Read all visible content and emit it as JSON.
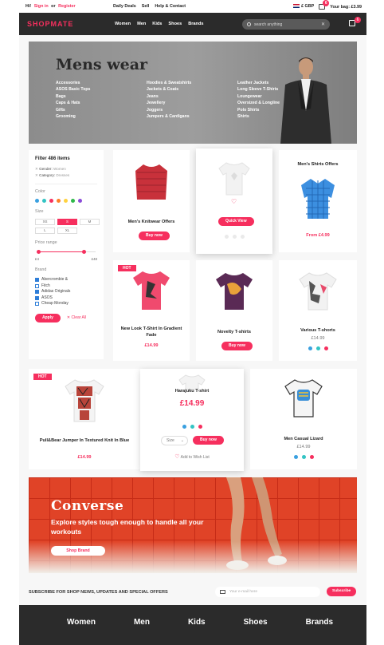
{
  "topbar": {
    "greeting": "Hi!",
    "signin": "Sign in",
    "or": "or",
    "register": "Register",
    "links": [
      "Daily Deals",
      "Sell",
      "Help & Contact"
    ],
    "currency": "£ GBP",
    "bag_count": "6",
    "bag_label": "Your bag: £3.99"
  },
  "nav": {
    "logo": "SHOPMATE",
    "links": [
      "Women",
      "Men",
      "Kids",
      "Shoes",
      "Brands"
    ],
    "search_placeholder": "search anything",
    "bag_count": "6"
  },
  "hero": {
    "title": "Mens wear",
    "columns": [
      [
        "Accessories",
        "ASOS Basic Tops",
        "Bags",
        "Caps & Hats",
        "Gifts",
        "Grooming"
      ],
      [
        "Hoodies & Sweatshirts",
        "Jackets & Coats",
        "Jeans",
        "Jewellery",
        "Joggers",
        "Jumpers & Cardigans"
      ],
      [
        "Leather Jackets",
        "Long Sleeve T-Shirts",
        "Loungewear",
        "Oversized & Longline",
        "Polo Shirts",
        "Shirts"
      ]
    ]
  },
  "filter": {
    "title": "Filter 486 items",
    "tags": [
      {
        "key": "Gender:",
        "value": "Women"
      },
      {
        "key": "Category:",
        "value": "Dresses"
      }
    ],
    "color_label": "Color",
    "colors": [
      "#3aa0e0",
      "#33c4c4",
      "#f62f5e",
      "#ff7f27",
      "#ffd23f",
      "#2fb84a",
      "#8a4bd8"
    ],
    "size_label": "Size",
    "sizes": [
      "XS",
      "S",
      "M",
      "L",
      "XL"
    ],
    "selected_size": "S",
    "price_label": "Price range",
    "price_min": "£4",
    "price_max": "£48",
    "brand_label": "Brand",
    "brands": [
      {
        "name": "Abercrombie &",
        "checked": true
      },
      {
        "name": "Fitch",
        "checked": false
      },
      {
        "name": "Adidas Originals",
        "checked": true
      },
      {
        "name": "ASOS",
        "checked": true
      },
      {
        "name": "Cheap Monday",
        "checked": false
      }
    ],
    "apply": "Apply",
    "clear": "✕  Clear All"
  },
  "products": {
    "knitwear": {
      "title": "Men's Knitwear Offers",
      "button": "Buy now"
    },
    "quickview": {
      "button": "Quick View"
    },
    "shirts": {
      "title": "Men's Shirts Offers",
      "price": "From £4.99"
    },
    "newlook": {
      "hot": "HOT",
      "title": "New Look T-Shirt In Gradient Fade",
      "price": "£14.99"
    },
    "novelty": {
      "title": "Novelty T-shirts",
      "button": "Buy now"
    },
    "various": {
      "title": "Various T-shorts",
      "price": "£14.99"
    },
    "pullbear": {
      "hot": "HOT",
      "title": "Pull&Bear Jumper In Textured Knit In Blue",
      "price": "£14.99"
    },
    "harajuku": {
      "title": "Harajuku T-shirt",
      "price": "£14.99",
      "size": "Size",
      "button": "Buy now",
      "wishlist": "Add to Wish List"
    },
    "lizard": {
      "title": "Men Casual Lizard",
      "price": "£14.99"
    }
  },
  "banner": {
    "title": "Converse",
    "subtitle": "Explore styles tough enough to handle all your workouts",
    "button": "Shop Brand"
  },
  "subscribe": {
    "text": "SUBSCRIBE FOR SHOP NEWS, UPDATES AND SPECIAL OFFERS",
    "placeholder": "Your e-mail here",
    "button": "Subscribe"
  },
  "footer": {
    "links": [
      "Women",
      "Men",
      "Kids",
      "Shoes",
      "Brands"
    ]
  }
}
